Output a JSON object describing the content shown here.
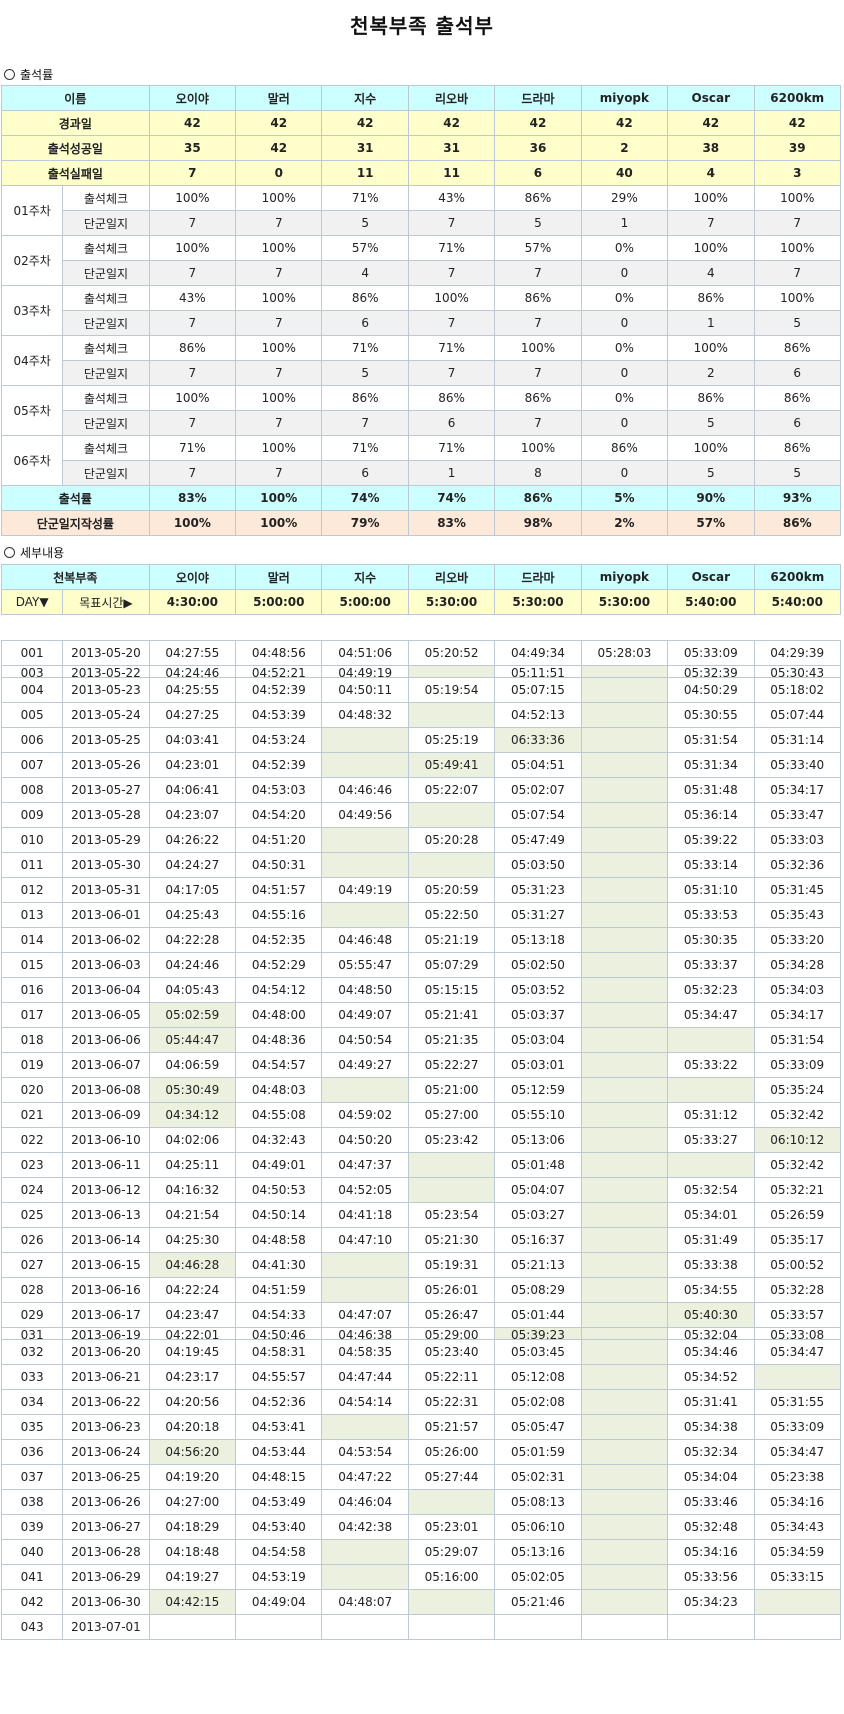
{
  "title": "천복부족 출석부",
  "section1": "출석률",
  "section2": "세부내용",
  "members": [
    "오이야",
    "말러",
    "지수",
    "리오바",
    "드라마",
    "miyopk",
    "Oscar",
    "6200km"
  ],
  "summary": {
    "name_header": "이름",
    "elapsed": {
      "label": "경과일",
      "values": [
        "42",
        "42",
        "42",
        "42",
        "42",
        "42",
        "42",
        "42"
      ]
    },
    "success": {
      "label": "출석성공일",
      "values": [
        "35",
        "42",
        "31",
        "31",
        "36",
        "2",
        "38",
        "39"
      ]
    },
    "fail": {
      "label": "출석실패일",
      "values": [
        "7",
        "0",
        "11",
        "11",
        "6",
        "40",
        "4",
        "3"
      ]
    },
    "check_label": "출석체크",
    "log_label": "단군일지",
    "weeks": [
      {
        "week": "01주차",
        "check": [
          "100%",
          "100%",
          "71%",
          "43%",
          "86%",
          "29%",
          "100%",
          "100%"
        ],
        "log": [
          "7",
          "7",
          "5",
          "7",
          "5",
          "1",
          "7",
          "7"
        ]
      },
      {
        "week": "02주차",
        "check": [
          "100%",
          "100%",
          "57%",
          "71%",
          "57%",
          "0%",
          "100%",
          "100%"
        ],
        "log": [
          "7",
          "7",
          "4",
          "7",
          "7",
          "0",
          "4",
          "7"
        ]
      },
      {
        "week": "03주차",
        "check": [
          "43%",
          "100%",
          "86%",
          "100%",
          "86%",
          "0%",
          "86%",
          "100%"
        ],
        "log": [
          "7",
          "7",
          "6",
          "7",
          "7",
          "0",
          "1",
          "5"
        ]
      },
      {
        "week": "04주차",
        "check": [
          "86%",
          "100%",
          "71%",
          "71%",
          "100%",
          "0%",
          "100%",
          "86%"
        ],
        "log": [
          "7",
          "7",
          "5",
          "7",
          "7",
          "0",
          "2",
          "6"
        ]
      },
      {
        "week": "05주차",
        "check": [
          "100%",
          "100%",
          "86%",
          "86%",
          "86%",
          "0%",
          "86%",
          "86%"
        ],
        "log": [
          "7",
          "7",
          "7",
          "6",
          "7",
          "0",
          "5",
          "6"
        ]
      },
      {
        "week": "06주차",
        "check": [
          "71%",
          "100%",
          "71%",
          "71%",
          "100%",
          "86%",
          "100%",
          "86%"
        ],
        "log": [
          "7",
          "7",
          "6",
          "1",
          "8",
          "0",
          "5",
          "5"
        ]
      }
    ],
    "rate": {
      "label": "출석률",
      "values": [
        "83%",
        "100%",
        "74%",
        "74%",
        "86%",
        "5%",
        "90%",
        "93%"
      ]
    },
    "log_rate": {
      "label": "단군일지작성률",
      "values": [
        "100%",
        "100%",
        "79%",
        "83%",
        "98%",
        "2%",
        "57%",
        "86%"
      ]
    }
  },
  "detail": {
    "tribe_header": "천복부족",
    "day_header": "DAY▼",
    "target_header": "목표시간▶",
    "targets": [
      "4:30:00",
      "5:00:00",
      "5:00:00",
      "5:30:00",
      "5:30:00",
      "5:30:00",
      "5:40:00",
      "5:40:00"
    ],
    "rows": [
      {
        "day": "001",
        "date": "2013-05-20",
        "t": [
          "04:27:55",
          "04:48:56",
          "04:51:06",
          "05:20:52",
          "04:49:34",
          "05:28:03",
          "05:33:09",
          "04:29:39"
        ],
        "miss": []
      },
      {
        "day": "003",
        "date": "2013-05-22",
        "t": [
          "04:24:46",
          "04:52:21",
          "04:49:19",
          "",
          "05:11:51",
          "",
          "05:32:39",
          "05:30:43"
        ],
        "miss": [
          3,
          5
        ],
        "cut": true
      },
      {
        "day": "004",
        "date": "2013-05-23",
        "t": [
          "04:25:55",
          "04:52:39",
          "04:50:11",
          "05:19:54",
          "05:07:15",
          "",
          "04:50:29",
          "05:18:02"
        ],
        "miss": [
          5
        ]
      },
      {
        "day": "005",
        "date": "2013-05-24",
        "t": [
          "04:27:25",
          "04:53:39",
          "04:48:32",
          "",
          "04:52:13",
          "",
          "05:30:55",
          "05:07:44"
        ],
        "miss": [
          3,
          5
        ]
      },
      {
        "day": "006",
        "date": "2013-05-25",
        "t": [
          "04:03:41",
          "04:53:24",
          "",
          "05:25:19",
          "06:33:36",
          "",
          "05:31:54",
          "05:31:14"
        ],
        "miss": [
          2,
          4,
          5
        ]
      },
      {
        "day": "007",
        "date": "2013-05-26",
        "t": [
          "04:23:01",
          "04:52:39",
          "",
          "05:49:41",
          "05:04:51",
          "",
          "05:31:34",
          "05:33:40"
        ],
        "miss": [
          2,
          3,
          5
        ]
      },
      {
        "day": "008",
        "date": "2013-05-27",
        "t": [
          "04:06:41",
          "04:53:03",
          "04:46:46",
          "05:22:07",
          "05:02:07",
          "",
          "05:31:48",
          "05:34:17"
        ],
        "miss": [
          5
        ]
      },
      {
        "day": "009",
        "date": "2013-05-28",
        "t": [
          "04:23:07",
          "04:54:20",
          "04:49:56",
          "",
          "05:07:54",
          "",
          "05:36:14",
          "05:33:47"
        ],
        "miss": [
          3,
          5
        ]
      },
      {
        "day": "010",
        "date": "2013-05-29",
        "t": [
          "04:26:22",
          "04:51:20",
          "",
          "05:20:28",
          "05:47:49",
          "",
          "05:39:22",
          "05:33:03"
        ],
        "miss": [
          2,
          5
        ]
      },
      {
        "day": "011",
        "date": "2013-05-30",
        "t": [
          "04:24:27",
          "04:50:31",
          "",
          "",
          "05:03:50",
          "",
          "05:33:14",
          "05:32:36"
        ],
        "miss": [
          2,
          3,
          5
        ]
      },
      {
        "day": "012",
        "date": "2013-05-31",
        "t": [
          "04:17:05",
          "04:51:57",
          "04:49:19",
          "05:20:59",
          "05:31:23",
          "",
          "05:31:10",
          "05:31:45"
        ],
        "miss": [
          5
        ]
      },
      {
        "day": "013",
        "date": "2013-06-01",
        "t": [
          "04:25:43",
          "04:55:16",
          "",
          "05:22:50",
          "05:31:27",
          "",
          "05:33:53",
          "05:35:43"
        ],
        "miss": [
          2,
          5
        ]
      },
      {
        "day": "014",
        "date": "2013-06-02",
        "t": [
          "04:22:28",
          "04:52:35",
          "04:46:48",
          "05:21:19",
          "05:13:18",
          "",
          "05:30:35",
          "05:33:20"
        ],
        "miss": [
          5
        ]
      },
      {
        "day": "015",
        "date": "2013-06-03",
        "t": [
          "04:24:46",
          "04:52:29",
          "05:55:47",
          "05:07:29",
          "05:02:50",
          "",
          "05:33:37",
          "05:34:28"
        ],
        "miss": [
          5
        ]
      },
      {
        "day": "016",
        "date": "2013-06-04",
        "t": [
          "04:05:43",
          "04:54:12",
          "04:48:50",
          "05:15:15",
          "05:03:52",
          "",
          "05:32:23",
          "05:34:03"
        ],
        "miss": [
          5
        ]
      },
      {
        "day": "017",
        "date": "2013-06-05",
        "t": [
          "05:02:59",
          "04:48:00",
          "04:49:07",
          "05:21:41",
          "05:03:37",
          "",
          "05:34:47",
          "05:34:17"
        ],
        "miss": [
          0,
          5
        ]
      },
      {
        "day": "018",
        "date": "2013-06-06",
        "t": [
          "05:44:47",
          "04:48:36",
          "04:50:54",
          "05:21:35",
          "05:03:04",
          "",
          "",
          "05:31:54"
        ],
        "miss": [
          0,
          5,
          6
        ]
      },
      {
        "day": "019",
        "date": "2013-06-07",
        "t": [
          "04:06:59",
          "04:54:57",
          "04:49:27",
          "05:22:27",
          "05:03:01",
          "",
          "05:33:22",
          "05:33:09"
        ],
        "miss": [
          5
        ]
      },
      {
        "day": "020",
        "date": "2013-06-08",
        "t": [
          "05:30:49",
          "04:48:03",
          "",
          "05:21:00",
          "05:12:59",
          "",
          "",
          "05:35:24"
        ],
        "miss": [
          0,
          2,
          5,
          6
        ]
      },
      {
        "day": "021",
        "date": "2013-06-09",
        "t": [
          "04:34:12",
          "04:55:08",
          "04:59:02",
          "05:27:00",
          "05:55:10",
          "",
          "05:31:12",
          "05:32:42"
        ],
        "miss": [
          0,
          5
        ]
      },
      {
        "day": "022",
        "date": "2013-06-10",
        "t": [
          "04:02:06",
          "04:32:43",
          "04:50:20",
          "05:23:42",
          "05:13:06",
          "",
          "05:33:27",
          "06:10:12"
        ],
        "miss": [
          5,
          7
        ]
      },
      {
        "day": "023",
        "date": "2013-06-11",
        "t": [
          "04:25:11",
          "04:49:01",
          "04:47:37",
          "",
          "05:01:48",
          "",
          "",
          "05:32:42"
        ],
        "miss": [
          3,
          5,
          6
        ]
      },
      {
        "day": "024",
        "date": "2013-06-12",
        "t": [
          "04:16:32",
          "04:50:53",
          "04:52:05",
          "",
          "05:04:07",
          "",
          "05:32:54",
          "05:32:21"
        ],
        "miss": [
          3,
          5
        ]
      },
      {
        "day": "025",
        "date": "2013-06-13",
        "t": [
          "04:21:54",
          "04:50:14",
          "04:41:18",
          "05:23:54",
          "05:03:27",
          "",
          "05:34:01",
          "05:26:59"
        ],
        "miss": [
          5
        ]
      },
      {
        "day": "026",
        "date": "2013-06-14",
        "t": [
          "04:25:30",
          "04:48:58",
          "04:47:10",
          "05:21:30",
          "05:16:37",
          "",
          "05:31:49",
          "05:35:17"
        ],
        "miss": [
          5
        ]
      },
      {
        "day": "027",
        "date": "2013-06-15",
        "t": [
          "04:46:28",
          "04:41:30",
          "",
          "05:19:31",
          "05:21:13",
          "",
          "05:33:38",
          "05:00:52"
        ],
        "miss": [
          0,
          2,
          5
        ]
      },
      {
        "day": "028",
        "date": "2013-06-16",
        "t": [
          "04:22:24",
          "04:51:59",
          "",
          "05:26:01",
          "05:08:29",
          "",
          "05:34:55",
          "05:32:28"
        ],
        "miss": [
          2,
          5
        ]
      },
      {
        "day": "029",
        "date": "2013-06-17",
        "t": [
          "04:23:47",
          "04:54:33",
          "04:47:07",
          "05:26:47",
          "05:01:44",
          "",
          "05:40:30",
          "05:33:57"
        ],
        "miss": [
          5,
          6
        ]
      },
      {
        "day": "031",
        "date": "2013-06-19",
        "t": [
          "04:22:01",
          "04:50:46",
          "04:46:38",
          "05:29:00",
          "05:39:23",
          "",
          "05:32:04",
          "05:33:08"
        ],
        "miss": [
          4,
          5
        ],
        "cut": true
      },
      {
        "day": "032",
        "date": "2013-06-20",
        "t": [
          "04:19:45",
          "04:58:31",
          "04:58:35",
          "05:23:40",
          "05:03:45",
          "",
          "05:34:46",
          "05:34:47"
        ],
        "miss": [
          5
        ]
      },
      {
        "day": "033",
        "date": "2013-06-21",
        "t": [
          "04:23:17",
          "04:55:57",
          "04:47:44",
          "05:22:11",
          "05:12:08",
          "",
          "05:34:52",
          ""
        ],
        "miss": [
          5,
          7
        ]
      },
      {
        "day": "034",
        "date": "2013-06-22",
        "t": [
          "04:20:56",
          "04:52:36",
          "04:54:14",
          "05:22:31",
          "05:02:08",
          "",
          "05:31:41",
          "05:31:55"
        ],
        "miss": [
          5
        ]
      },
      {
        "day": "035",
        "date": "2013-06-23",
        "t": [
          "04:20:18",
          "04:53:41",
          "",
          "05:21:57",
          "05:05:47",
          "",
          "05:34:38",
          "05:33:09"
        ],
        "miss": [
          2,
          5
        ]
      },
      {
        "day": "036",
        "date": "2013-06-24",
        "t": [
          "04:56:20",
          "04:53:44",
          "04:53:54",
          "05:26:00",
          "05:01:59",
          "",
          "05:32:34",
          "05:34:47"
        ],
        "miss": [
          0,
          5
        ]
      },
      {
        "day": "037",
        "date": "2013-06-25",
        "t": [
          "04:19:20",
          "04:48:15",
          "04:47:22",
          "05:27:44",
          "05:02:31",
          "",
          "05:34:04",
          "05:23:38"
        ],
        "miss": [
          5
        ]
      },
      {
        "day": "038",
        "date": "2013-06-26",
        "t": [
          "04:27:00",
          "04:53:49",
          "04:46:04",
          "",
          "05:08:13",
          "",
          "05:33:46",
          "05:34:16"
        ],
        "miss": [
          3,
          5
        ]
      },
      {
        "day": "039",
        "date": "2013-06-27",
        "t": [
          "04:18:29",
          "04:53:40",
          "04:42:38",
          "05:23:01",
          "05:06:10",
          "",
          "05:32:48",
          "05:34:43"
        ],
        "miss": [
          5
        ]
      },
      {
        "day": "040",
        "date": "2013-06-28",
        "t": [
          "04:18:48",
          "04:54:58",
          "",
          "05:29:07",
          "05:13:16",
          "",
          "05:34:16",
          "05:34:59"
        ],
        "miss": [
          2,
          5
        ]
      },
      {
        "day": "041",
        "date": "2013-06-29",
        "t": [
          "04:19:27",
          "04:53:19",
          "",
          "05:16:00",
          "05:02:05",
          "",
          "05:33:56",
          "05:33:15"
        ],
        "miss": [
          2,
          5
        ]
      },
      {
        "day": "042",
        "date": "2013-06-30",
        "t": [
          "04:42:15",
          "04:49:04",
          "04:48:07",
          "",
          "05:21:46",
          "",
          "05:34:23",
          ""
        ],
        "miss": [
          0,
          3,
          5,
          7
        ]
      },
      {
        "day": "043",
        "date": "2013-07-01",
        "t": [
          "",
          "",
          "",
          "",
          "",
          "",
          "",
          ""
        ],
        "miss": []
      }
    ]
  }
}
